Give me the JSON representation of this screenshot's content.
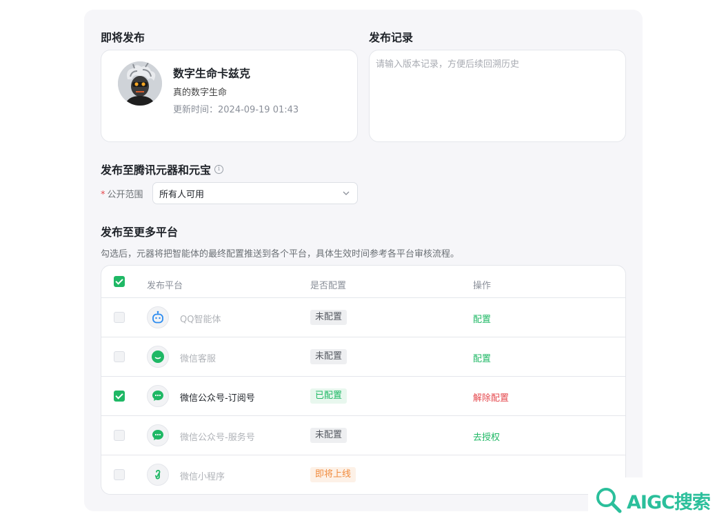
{
  "publish_soon": {
    "title": "即将发布",
    "bot": {
      "name": "数字生命卡兹克",
      "description": "真的数字生命",
      "update_label": "更新时间：",
      "update_time": "2024-09-19 01:43"
    }
  },
  "record": {
    "title": "发布记录",
    "placeholder": "请输入版本记录，方便后续回溯历史"
  },
  "tencent": {
    "title": "发布至腾讯元器和元宝",
    "info_glyph": "i",
    "scope_required_mark": "*",
    "scope_label": "公开范围",
    "scope_value": "所有人可用"
  },
  "more_platforms": {
    "title": "发布至更多平台",
    "description": "勾选后，元器将把智能体的最终配置推送到各个平台，具体生效时间参考各平台审核流程。",
    "header_checked": true,
    "columns": [
      "发布平台",
      "是否配置",
      "操作"
    ],
    "rows": [
      {
        "platform": "QQ智能体",
        "icon": "qq-bot-icon",
        "checked": false,
        "status": "未配置",
        "status_color": "gray",
        "action": "配置",
        "action_color": "green"
      },
      {
        "platform": "微信客服",
        "icon": "wechat-service-icon",
        "checked": false,
        "status": "未配置",
        "status_color": "gray",
        "action": "配置",
        "action_color": "green"
      },
      {
        "platform": "微信公众号-订阅号",
        "icon": "wechat-icon",
        "checked": true,
        "status": "已配置",
        "status_color": "green",
        "action": "解除配置",
        "action_color": "red"
      },
      {
        "platform": "微信公众号-服务号",
        "icon": "wechat-icon",
        "checked": false,
        "status": "未配置",
        "status_color": "gray",
        "action": "去授权",
        "action_color": "green"
      },
      {
        "platform": "微信小程序",
        "icon": "mini-program-icon",
        "checked": false,
        "status": "即将上线",
        "status_color": "orange",
        "action": "",
        "action_color": ""
      }
    ]
  },
  "colors": {
    "accent_green": "#1fb865",
    "danger_red": "#e5484d",
    "soon_orange": "#f08a3c"
  },
  "watermark": {
    "text": "AIGC搜索"
  }
}
